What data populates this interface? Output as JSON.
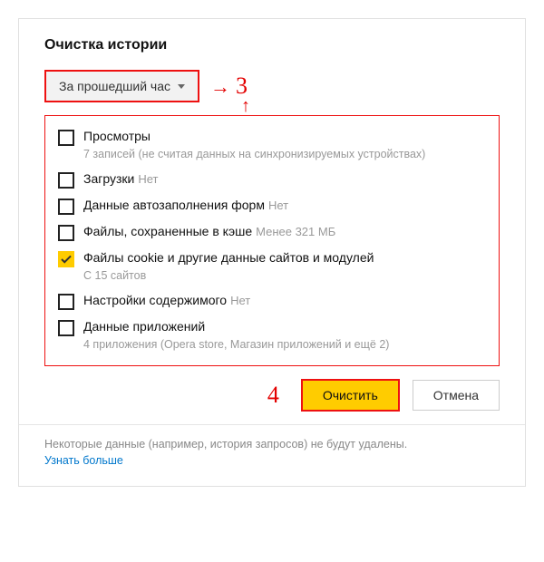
{
  "dialog": {
    "title": "Очистка истории",
    "time_range": {
      "selected": "За прошедший час"
    }
  },
  "annotations": {
    "step3": "3",
    "step4": "4"
  },
  "options": [
    {
      "checked": false,
      "label": "Просмотры",
      "sub": "7 записей (не считая данных на синхронизируемых устройствах)"
    },
    {
      "checked": false,
      "label": "Загрузки",
      "hint": "Нет"
    },
    {
      "checked": false,
      "label": "Данные автозаполнения форм",
      "hint": "Нет"
    },
    {
      "checked": false,
      "label": "Файлы, сохраненные в кэше",
      "hint": "Менее 321 МБ"
    },
    {
      "checked": true,
      "label": "Файлы cookie и другие данные сайтов и модулей",
      "sub": "С 15 сайтов"
    },
    {
      "checked": false,
      "label": "Настройки содержимого",
      "hint": "Нет"
    },
    {
      "checked": false,
      "label": "Данные приложений",
      "sub": "4 приложения (Opera store, Магазин приложений и ещё 2)"
    }
  ],
  "buttons": {
    "clear": "Очистить",
    "cancel": "Отмена"
  },
  "footer": {
    "text": "Некоторые данные (например, история запросов) не будут удалены.",
    "link": "Узнать больше"
  }
}
